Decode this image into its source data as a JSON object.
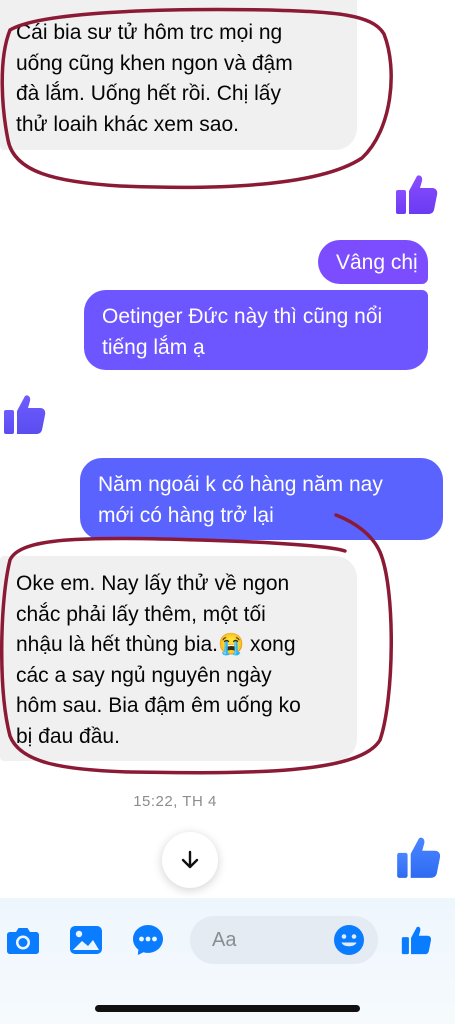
{
  "colors": {
    "accent": "#7c4dff",
    "incoming_bubble": "#f0f0f0",
    "annotation": "#8b1a35"
  },
  "messages": [
    {
      "direction": "incoming",
      "lines": [
        "Cái bia sư tử hôm trc mọi ng",
        "uống cũng khen ngon và đậm",
        "đà lắm. Uống hết rồi. Chị lấy",
        "thử loaih khác xem sao."
      ]
    },
    {
      "direction": "outgoing",
      "lines": [
        "Vâng chị"
      ]
    },
    {
      "direction": "outgoing",
      "lines": [
        "Oetinger Đức này thì cũng nổi",
        "tiếng lắm ạ"
      ]
    },
    {
      "direction": "outgoing",
      "lines": [
        "Năm ngoái k có hàng năm nay",
        "mới có hàng trở lại"
      ]
    },
    {
      "direction": "incoming",
      "lines": [
        "Oke em. Nay lấy thử về ngon",
        "chắc phải lấy thêm, một tối",
        "nhậu là hết thùng bia.😭 xong",
        "các a say ngủ nguyên ngày",
        "hôm sau. Bia đậm êm uống ko",
        "bị đau đầu."
      ]
    }
  ],
  "timestamp": "15:22, TH 4",
  "composer": {
    "placeholder": "Aa",
    "icons": [
      "camera-icon",
      "image-icon",
      "chat-bubble-dots-icon",
      "emoji-icon",
      "thumbs-up-icon"
    ]
  }
}
